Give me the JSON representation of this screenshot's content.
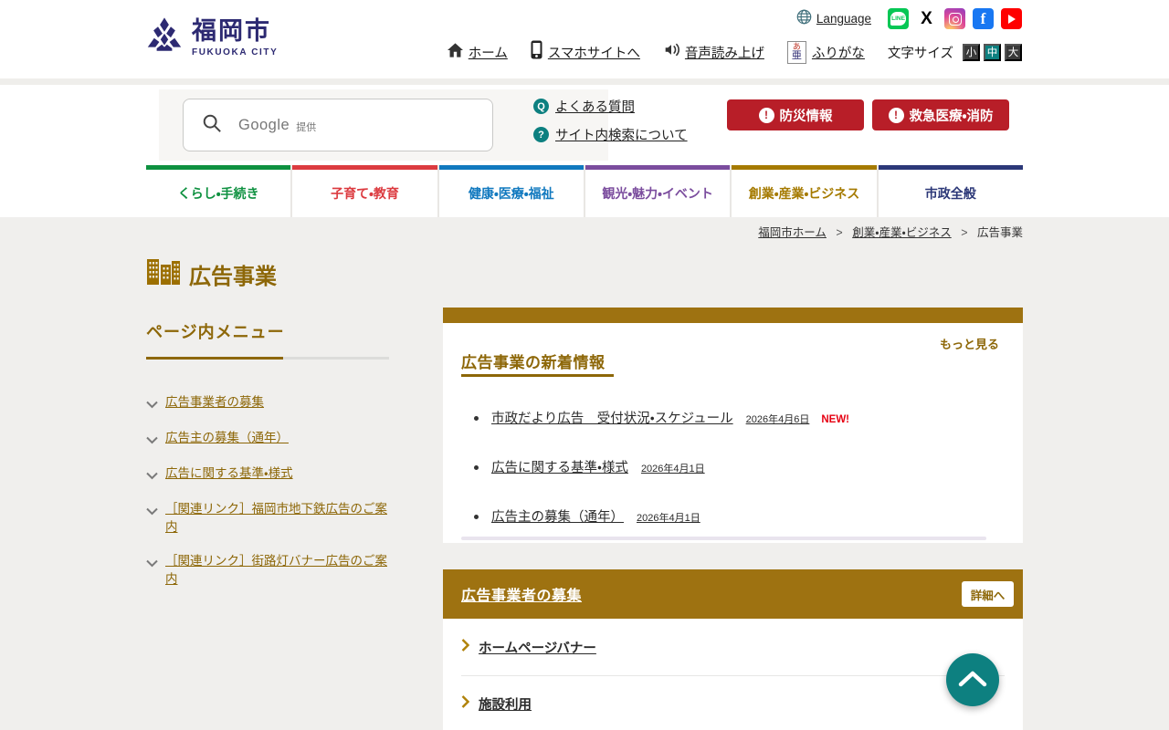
{
  "brand": {
    "logo_jp": "福岡市",
    "logo_en": "FUKUOKA CITY"
  },
  "utility": {
    "language_label": "Language",
    "social": [
      "LINE",
      "X",
      "Instagram",
      "Facebook",
      "YouTube"
    ]
  },
  "icons": {
    "line_glyph": "LINE",
    "x_glyph": "X",
    "facebook_glyph": "f",
    "q_glyph": "Q",
    "question_glyph": "?",
    "exclaim_glyph": "!",
    "furigana_top": "あ",
    "furigana_bottom": "亜"
  },
  "header_nav": {
    "home": "ホーム",
    "smartphone": "スマホサイトへ",
    "voice": "音声読み上げ",
    "furigana": "ふりがな",
    "text_size_label": "文字サイズ",
    "sizes": [
      "小",
      "中",
      "大"
    ],
    "active_size": "中"
  },
  "search": {
    "brand": "Google",
    "provided": "提供"
  },
  "quick_links": [
    {
      "label": "よくある質問"
    },
    {
      "label": "サイト内検索について"
    }
  ],
  "emergency_buttons": [
    {
      "label": "防災情報"
    },
    {
      "label": "救急医療・消防"
    }
  ],
  "category_tabs": [
    {
      "label": "くらし・手続き",
      "color": "#0e9140"
    },
    {
      "label": "子育て・教育",
      "color": "#dc3b40"
    },
    {
      "label": "健康・医療・福祉",
      "color": "#1179bf"
    },
    {
      "label": "観光・魅力・イベント",
      "color": "#7b4d9e"
    },
    {
      "label": "創業・産業・ビジネス",
      "color": "#a57a00"
    },
    {
      "label": "市政全般",
      "color": "#2c3878"
    }
  ],
  "breadcrumb": {
    "separator": ">",
    "items": [
      {
        "label": "福岡市ホーム"
      },
      {
        "label": "創業・産業・ビジネス"
      },
      {
        "label": "広告事業"
      }
    ]
  },
  "page": {
    "title": "広告事業"
  },
  "sidebar": {
    "heading": "ページ内メニュー",
    "items": [
      {
        "label": "広告事業者の募集"
      },
      {
        "label": "広告主の募集（通年）"
      },
      {
        "label": "広告に関する基準・様式"
      },
      {
        "label": "［関連リンク］福岡市地下鉄広告のご案内"
      },
      {
        "label": "［関連リンク］街路灯バナー広告のご案内"
      }
    ]
  },
  "news": {
    "heading": "広告事業の新着情報",
    "more_label": "もっと見る",
    "items": [
      {
        "title": "市政だより広告　受付状況・スケジュール",
        "date": "2026年4月6日",
        "badge": "NEW!"
      },
      {
        "title": "広告に関する基準・様式",
        "date": "2026年4月1日"
      },
      {
        "title": "広告主の募集（通年）",
        "date": "2026年4月1日"
      }
    ]
  },
  "recruit": {
    "heading": "広告事業者の募集",
    "detail_button": "詳細へ",
    "links": [
      {
        "label": "ホームページバナー"
      },
      {
        "label": "施設利用"
      }
    ]
  },
  "colors": {
    "logo_navy": "#2d2a72",
    "accent_gold": "#8d6708",
    "gold_bar": "#9e7211",
    "teal": "#0d8080",
    "emergency_red": "#b81e28",
    "new_red": "#e60012",
    "content_bg": "#f0efed"
  }
}
